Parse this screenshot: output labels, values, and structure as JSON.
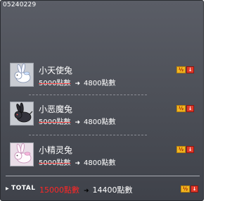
{
  "header": {
    "code": "05240229"
  },
  "items": [
    {
      "name": "小天使兔",
      "original_price": "5000點數",
      "sale_price": "4800點數",
      "icon": "white-rabbit-icon"
    },
    {
      "name": "小恶魔兔",
      "original_price": "5000點數",
      "sale_price": "4800點數",
      "icon": "black-rabbit-icon"
    },
    {
      "name": "小精灵兔",
      "original_price": "5000點數",
      "sale_price": "4800點數",
      "icon": "pink-rabbit-icon"
    }
  ],
  "badge": {
    "label_left": "½",
    "label_right": "↓"
  },
  "total": {
    "label": "TOTAL",
    "original": "15000點數",
    "final": "14400點數"
  },
  "colors": {
    "panel": "#4e5159",
    "strike": "#ff4a4a",
    "total_old": "#ff2626",
    "badge_gold": "#f2b722",
    "badge_red": "#e03a2a"
  }
}
